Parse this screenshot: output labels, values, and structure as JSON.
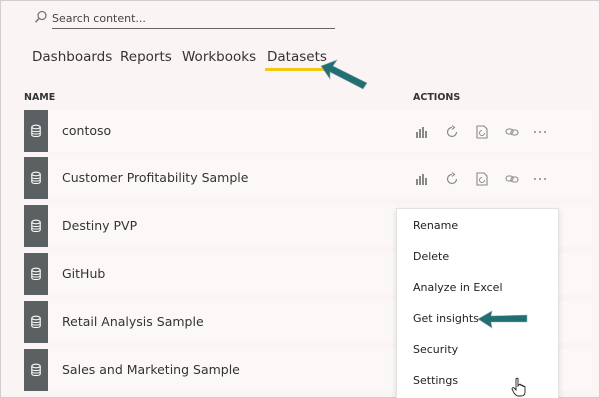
{
  "search": {
    "placeholder": "Search content..."
  },
  "tabs": [
    {
      "label": "Dashboards",
      "active": false
    },
    {
      "label": "Reports",
      "active": false
    },
    {
      "label": "Workbooks",
      "active": false
    },
    {
      "label": "Datasets",
      "active": true
    }
  ],
  "table": {
    "headers": {
      "name": "NAME",
      "actions": "ACTIONS"
    },
    "rows": [
      {
        "name": "contoso"
      },
      {
        "name": "Customer Profitability Sample"
      },
      {
        "name": "Destiny PVP"
      },
      {
        "name": "GitHub"
      },
      {
        "name": "Retail Analysis Sample"
      },
      {
        "name": "Sales and Marketing Sample"
      }
    ]
  },
  "context_menu": {
    "items": [
      {
        "label": "Rename"
      },
      {
        "label": "Delete"
      },
      {
        "label": "Analyze in Excel"
      },
      {
        "label": "Get insights"
      },
      {
        "label": "Security"
      },
      {
        "label": "Settings"
      }
    ]
  },
  "icons": {
    "dataset": "database-icon",
    "row_actions": [
      "create-report-icon",
      "refresh-icon",
      "schedule-refresh-icon",
      "link-icon",
      "more-options-icon"
    ],
    "annotation": "teal-arrow-icon",
    "cursor": "hand-pointer-icon"
  },
  "colors": {
    "accent": "#f2c811",
    "tile": "#5b6063",
    "arrow": "#1f6f73",
    "background": "#faf4f4"
  }
}
